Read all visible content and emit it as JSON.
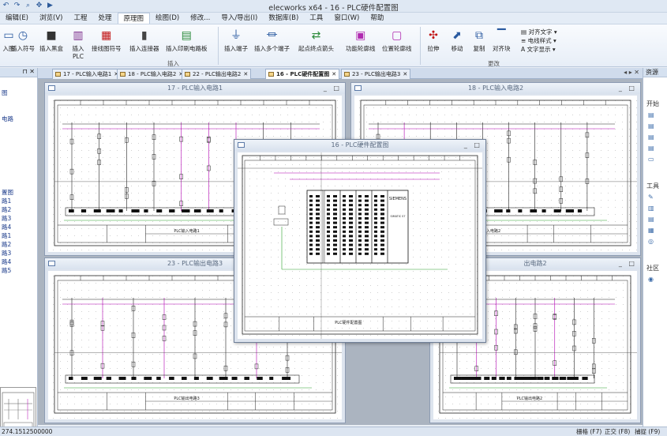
{
  "app_title": "elecworks x64 - 16 - PLC硬件配置图",
  "menus": [
    "编辑(E)",
    "浏览(V)",
    "工程",
    "处理",
    "原理图",
    "绘图(D)",
    "修改...",
    "导入/导出(I)",
    "数据库(B)",
    "工具",
    "窗口(W)",
    "帮助"
  ],
  "active_menu": "原理图",
  "ribbon": {
    "buttons": [
      {
        "label": "入图",
        "icon": "insert-drawing-icon"
      },
      {
        "label": "插入符号",
        "icon": "clock-symbol-icon"
      },
      {
        "label": "插入黑盒",
        "icon": "black-box-icon"
      },
      {
        "label": "插入",
        "label2": "PLC",
        "icon": "plc-icon"
      },
      {
        "label": "接线图符号",
        "icon": "wiring-symbol-icon"
      },
      {
        "label": "插入连接器",
        "icon": "connector-icon"
      },
      {
        "label": "插入印刷电路板",
        "icon": "pcb-icon"
      },
      {
        "label": "插入端子",
        "icon": "terminal-icon"
      },
      {
        "label": "插入多个端子",
        "icon": "multi-terminal-icon"
      },
      {
        "label": "起点终点箭头",
        "icon": "arrow-icon"
      },
      {
        "label": "功能轮廓线",
        "icon": "function-outline-icon"
      },
      {
        "label": "位置轮廓线",
        "icon": "location-outline-icon"
      },
      {
        "label": "拉伸",
        "icon": "stretch-icon"
      },
      {
        "label": "移动",
        "icon": "move-icon"
      },
      {
        "label": "复制",
        "icon": "copy-icon"
      },
      {
        "label": "对齐块",
        "icon": "align-block-icon"
      }
    ],
    "small_buttons": [
      "对齐文字",
      "电线样式",
      "文字显示"
    ],
    "groups": [
      "插入",
      "更改"
    ]
  },
  "left_panel": {
    "items": [
      "图",
      "电路",
      "置图",
      "路1",
      "路2",
      "路3",
      "路4",
      "路1",
      "路2",
      "路3",
      "路4",
      "路5"
    ]
  },
  "right_panel": {
    "title": "资源",
    "items": [
      "开始",
      "工具",
      "社区"
    ]
  },
  "tabs": [
    {
      "label": "17 - PLC输入电路1",
      "active": false
    },
    {
      "label": "18 - PLC输入电路2",
      "active": false
    },
    {
      "label": "22 - PLC输出电路2",
      "active": false
    },
    {
      "label": "16 - PLC硬件配置图",
      "active": true
    },
    {
      "label": "23 - PLC输出电路3",
      "active": false
    }
  ],
  "windows": [
    {
      "title": "17 - PLC输入电路1",
      "footer": "PLC输入电路1"
    },
    {
      "title": "18 - PLC输入电路2",
      "footer": "PLC输入电路2"
    },
    {
      "title": "23 - PLC输出电路3",
      "footer": "PLC输出电路3"
    },
    {
      "title": "出电路2",
      "footer": "PLC输出电路2"
    },
    {
      "title": "16 - PLC硬件配置图",
      "footer": "PLC硬件配置图"
    }
  ],
  "plc_label": "SIEMENS",
  "plc_sub": "SIMATIC S7",
  "status": {
    "coord": "274.1512500000",
    "items": [
      "栅格 (F7)",
      "正交 (F8)",
      "捕捉 (F9)"
    ]
  }
}
